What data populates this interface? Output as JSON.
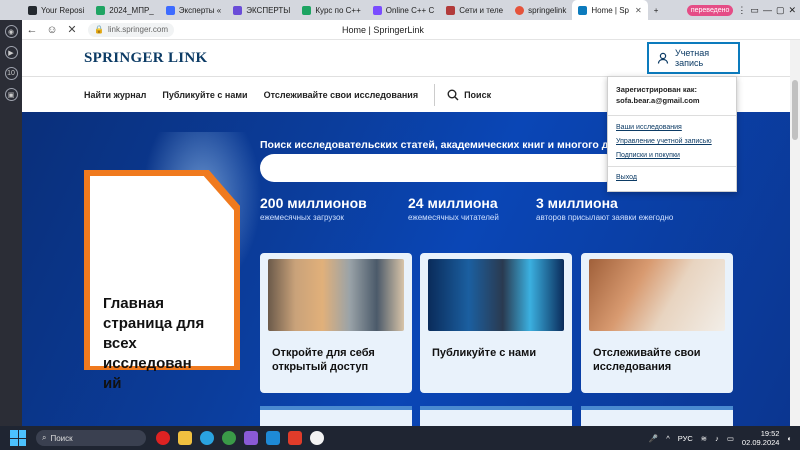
{
  "browser": {
    "tabs": [
      {
        "label": "Your Reposi",
        "color": "#24292f"
      },
      {
        "label": "2024_МПР_",
        "color": "#1fa463"
      },
      {
        "label": "Эксперты «",
        "color": "#3d6bff"
      },
      {
        "label": "ЭКСПЕРТЫ",
        "color": "#6a4cd8"
      },
      {
        "label": "Курс по С++",
        "color": "#1da462"
      },
      {
        "label": "Online C++ C",
        "color": "#7a4cff"
      },
      {
        "label": "Сети и теле",
        "color": "#b23a3a"
      },
      {
        "label": "springelink",
        "color": "#e5533b"
      },
      {
        "label": "Home | Sp",
        "color": "#0c7bbd"
      }
    ],
    "translated_badge": "переведено",
    "address": "link.springer.com",
    "page_title": "Home | SpringerLink"
  },
  "header": {
    "logo": "SPRINGER LINK",
    "account_button": "Учетная запись"
  },
  "nav": {
    "find_journal": "Найти журнал",
    "publish": "Публикуйте с нами",
    "track": "Отслеживайте свои исследования",
    "search": "Поиск"
  },
  "hero": {
    "title": "Поиск исследовательских статей, академических книг и многого другого",
    "stats": [
      {
        "big": "200 миллионов",
        "small": "ежемесячных загрузок"
      },
      {
        "big": "24 миллиона",
        "small": "ежемесячных читателей"
      },
      {
        "big": "3 миллиона",
        "small": "авторов присылают заявки ежегодно"
      }
    ],
    "box_title": "Главная страница для всех исследован ий"
  },
  "cards": [
    {
      "title": "Откройте для себя открытый доступ"
    },
    {
      "title": "Публикуйте с нами"
    },
    {
      "title": "Отслеживайте свои исследования"
    }
  ],
  "account_menu": {
    "label": "Зарегистрирован как:",
    "email": "sofa.bear.a@gmail.com",
    "links": [
      "Ваши исследования",
      "Управление учетной записью",
      "Подписки и покупки"
    ],
    "logout": "Выход"
  },
  "taskbar": {
    "search": "Поиск",
    "lang": "РУС",
    "time": "19:52",
    "date": "02.09.2024"
  }
}
